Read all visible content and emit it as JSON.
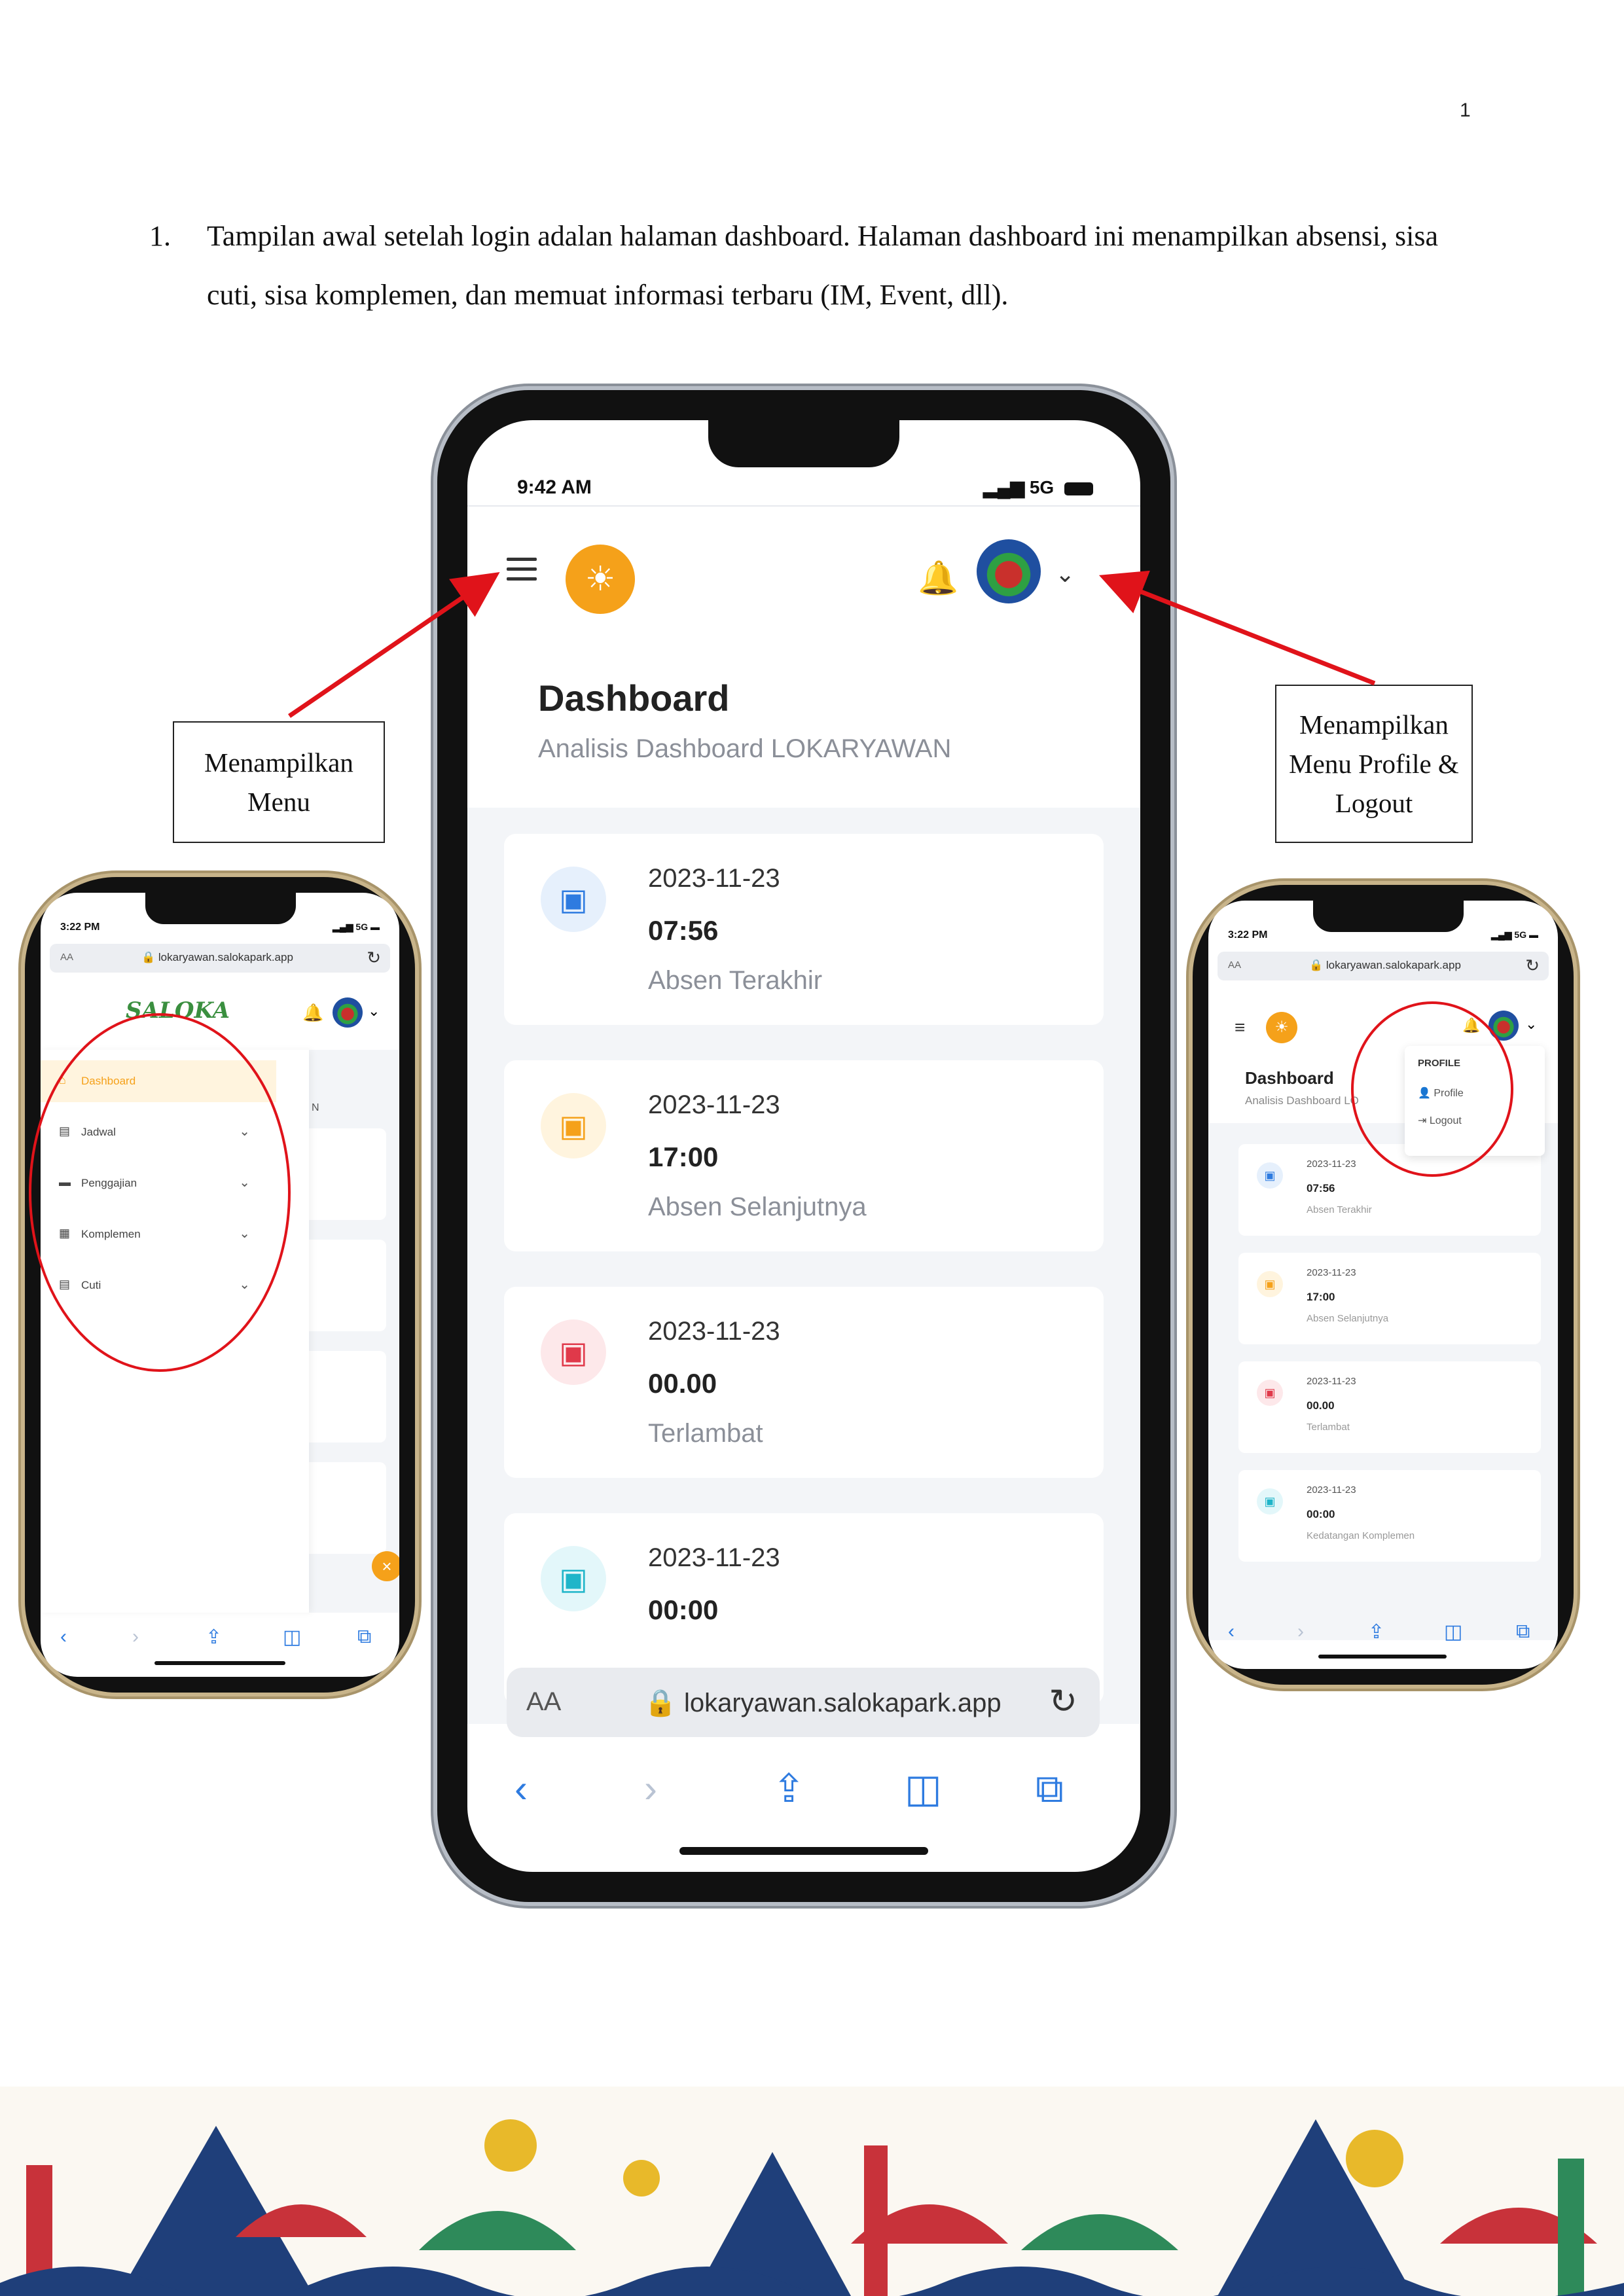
{
  "page_number": "1",
  "intro": {
    "number": "1.",
    "text": "Tampilan awal setelah login adalan halaman dashboard. Halaman dashboard ini menampilkan absensi, sisa cuti, sisa komplemen, dan memuat informasi terbaru (IM, Event, dll)."
  },
  "callouts": {
    "menu": "Menampilkan Menu",
    "profile": "Menampilkan Menu Profile & Logout"
  },
  "main_phone": {
    "time": "9:42 AM",
    "signal": "5G",
    "title": "Dashboard",
    "subtitle": "Analisis Dashboard LOKARYAWAN",
    "cards": [
      {
        "date": "2023-11-23",
        "time": "07:56",
        "label": "Absen Terakhir",
        "icon": "calendar-check-icon",
        "color": "#2e7be0",
        "bg": "#e6f0fc"
      },
      {
        "date": "2023-11-23",
        "time": "17:00",
        "label": "Absen Selanjutnya",
        "icon": "calendar-clock-icon",
        "color": "#f5a11a",
        "bg": "#fff4de"
      },
      {
        "date": "2023-11-23",
        "time": "00.00",
        "label": "Terlambat",
        "icon": "calendar-alert-icon",
        "color": "#e0394a",
        "bg": "#fde8ea"
      },
      {
        "date": "2023-11-23",
        "time": "00:00",
        "label": "",
        "icon": "calendar-plus-icon",
        "color": "#1fb5c9",
        "bg": "#e3f7fa"
      }
    ],
    "url": "lokaryawan.salokapark.app",
    "url_aa": "AA"
  },
  "left_phone": {
    "time": "3:22 PM",
    "signal": "5G",
    "url": "lokaryawan.salokapark.app",
    "url_aa": "AA",
    "brand": "SALOKA",
    "backdrop_text": "N",
    "menu": [
      {
        "label": "Dashboard",
        "icon": "home-icon",
        "active": true
      },
      {
        "label": "Jadwal",
        "icon": "calendar-icon",
        "active": false
      },
      {
        "label": "Penggajian",
        "icon": "wallet-icon",
        "active": false
      },
      {
        "label": "Komplemen",
        "icon": "ticket-icon",
        "active": false
      },
      {
        "label": "Cuti",
        "icon": "calendar-icon",
        "active": false
      }
    ]
  },
  "right_phone": {
    "time": "3:22 PM",
    "signal": "5G",
    "url": "lokaryawan.salokapark.app",
    "url_aa": "AA",
    "title": "Dashboard",
    "subtitle": "Analisis Dashboard LO",
    "dropdown": {
      "header": "PROFILE",
      "items": [
        "Profile",
        "Logout"
      ]
    },
    "cards": [
      {
        "date": "2023-11-23",
        "time": "07:56",
        "label": "Absen Terakhir"
      },
      {
        "date": "2023-11-23",
        "time": "17:00",
        "label": "Absen Selanjutnya"
      },
      {
        "date": "2023-11-23",
        "time": "00.00",
        "label": "Terlambat"
      },
      {
        "date": "2023-11-23",
        "time": "00:00",
        "label": "Kedatangan Komplemen"
      }
    ]
  },
  "colors": {
    "accent": "#f5a11a",
    "link": "#2e7be0",
    "annotation": "#e0131a"
  }
}
